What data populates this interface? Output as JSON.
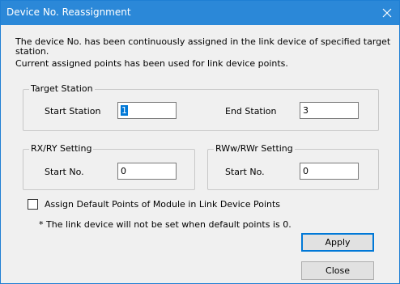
{
  "window": {
    "title": "Device No. Reassignment"
  },
  "description": {
    "line1": "The device No. has been continuously assigned in the link device of specified target",
    "line2": "station.",
    "line3": "Current assigned points has been used for link device points."
  },
  "target_station": {
    "legend": "Target Station",
    "start_label": "Start Station",
    "start_value": "1",
    "end_label": "End Station",
    "end_value": "3"
  },
  "rxry": {
    "legend": "RX/RY Setting",
    "start_label": "Start No.",
    "start_value": "0"
  },
  "rwwrwr": {
    "legend": "RWw/RWr Setting",
    "start_label": "Start No.",
    "start_value": "0"
  },
  "assign_default": {
    "label": "Assign Default Points of Module in Link Device Points",
    "checked": false,
    "note": "* The link device will not be set when default points is 0."
  },
  "buttons": {
    "apply": "Apply",
    "close": "Close"
  },
  "colors": {
    "titlebar": "#2b88d8",
    "selection": "#0078d7"
  }
}
